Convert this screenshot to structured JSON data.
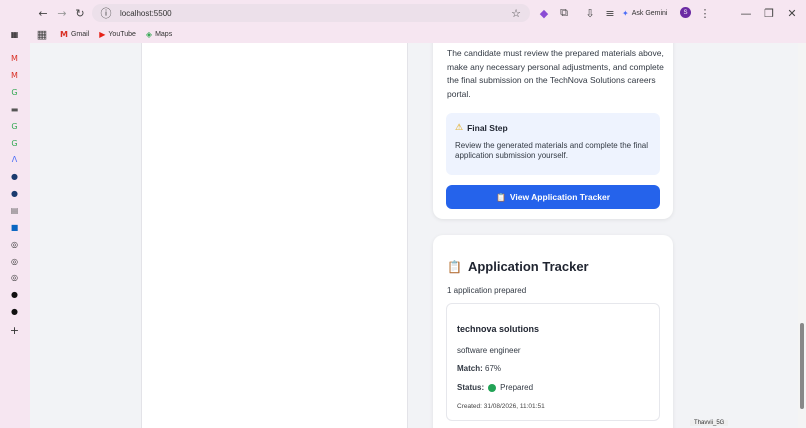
{
  "browser": {
    "url": "localhost:5500",
    "ask_gemini_label": "Ask Gemini",
    "profile_initial": "S",
    "bookmarks": [
      {
        "label": "Gmail"
      },
      {
        "label": "YouTube"
      },
      {
        "label": "Maps"
      }
    ]
  },
  "submission_card": {
    "description": "The candidate must review the prepared materials above, make any necessary personal adjustments, and complete the final submission on the TechNova Solutions careers portal.",
    "final_step_title": "Final Step",
    "final_step_text": "Review the generated materials and complete the final application submission yourself.",
    "view_tracker_button": "View Application Tracker"
  },
  "tracker": {
    "title": "Application Tracker",
    "count_text": "1 application prepared",
    "application": {
      "company": "technova solutions",
      "role": "software engineer",
      "match_label": "Match:",
      "match_value": "67%",
      "status_label": "Status:",
      "status_value": "Prepared",
      "created": "Created: 31/08/2026, 11:01:51"
    }
  },
  "system": {
    "wifi_tooltip": "Thavvii_5G"
  },
  "colors": {
    "accent": "#2563eb",
    "status_prepared": "#22a356",
    "callout_bg": "#eef3fe"
  }
}
